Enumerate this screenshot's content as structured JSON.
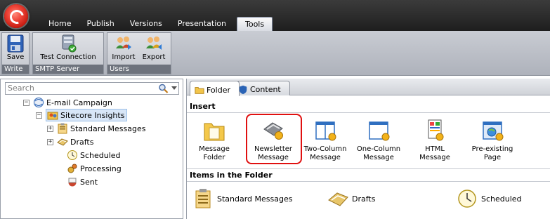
{
  "app": {
    "orb_icon": "sitecore-logo-icon"
  },
  "menu_tabs": [
    "Home",
    "Publish",
    "Versions",
    "Presentation",
    "Tools"
  ],
  "active_menu_tab": "Tools",
  "ribbon": {
    "groups": [
      {
        "label": "Write",
        "buttons": [
          {
            "label": "Save",
            "icon": "floppy-disk-icon"
          }
        ]
      },
      {
        "label": "SMTP Server",
        "buttons": [
          {
            "label": "Test Connection",
            "icon": "server-icon"
          }
        ]
      },
      {
        "label": "Users",
        "buttons": [
          {
            "label": "Import",
            "icon": "users-import-icon"
          },
          {
            "label": "Export",
            "icon": "users-export-icon"
          }
        ]
      }
    ]
  },
  "search": {
    "placeholder": "Search"
  },
  "tree": {
    "root": "E-mail Campaign",
    "child": "Sitecore Insights",
    "items": [
      "Standard Messages",
      "Drafts",
      "Scheduled",
      "Processing",
      "Sent"
    ]
  },
  "content_tabs": [
    "Folder",
    "Content"
  ],
  "active_content_tab": "Folder",
  "insert_section": {
    "title": "Insert",
    "items": [
      {
        "line1": "Message",
        "line2": "Folder",
        "icon": "message-folder-icon"
      },
      {
        "line1": "Newsletter",
        "line2": "Message",
        "icon": "newsletter-message-icon",
        "highlighted": true
      },
      {
        "line1": "Two-Column",
        "line2": "Message",
        "icon": "two-column-message-icon"
      },
      {
        "line1": "One-Column",
        "line2": "Message",
        "icon": "one-column-message-icon"
      },
      {
        "line1": "HTML",
        "line2": "Message",
        "icon": "html-message-icon"
      },
      {
        "line1": "Pre-existing",
        "line2": "Page",
        "icon": "pre-existing-page-icon"
      }
    ]
  },
  "folder_section": {
    "title": "Items in the Folder",
    "items": [
      "Standard Messages",
      "Drafts",
      "Scheduled"
    ]
  },
  "colors": {
    "highlight": "#e01010",
    "ribbon_label_bg": "#6e737d",
    "topbar": "#2a2a2a"
  }
}
